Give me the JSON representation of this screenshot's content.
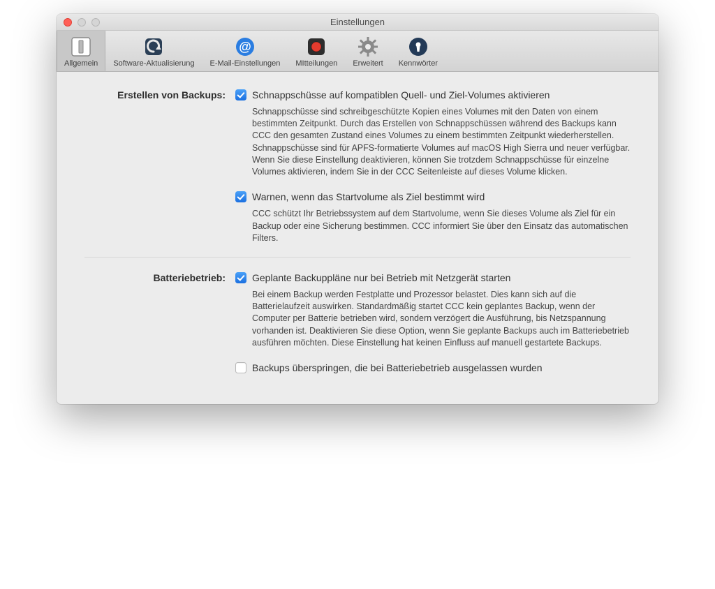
{
  "window_title": "Einstellungen",
  "toolbar": [
    {
      "label": "Allgemein",
      "selected": true
    },
    {
      "label": "Software-Aktualisierung",
      "selected": false
    },
    {
      "label": "E-Mail-Einstellungen",
      "selected": false
    },
    {
      "label": "MItteilungen",
      "selected": false
    },
    {
      "label": "Erweitert",
      "selected": false
    },
    {
      "label": "Kennwörter",
      "selected": false
    }
  ],
  "sections": {
    "backups": {
      "label": "Erstellen von Backups:",
      "options": [
        {
          "checked": true,
          "title": "Schnappschüsse auf kompatiblen Quell- und Ziel-Volumes aktivieren",
          "desc": "Schnappschüsse sind schreibgeschützte Kopien eines Volumes mit den Daten von einem bestimmten Zeitpunkt. Durch das Erstellen von Schnappschüssen während des Backups kann CCC den gesamten Zustand eines Volumes zu einem bestimmten Zeitpunkt wiederherstellen. Schnappschüsse sind für APFS-formatierte Volumes auf macOS High Sierra und neuer verfügbar. Wenn Sie diese Einstellung deaktivieren, können Sie trotzdem Schnappschüsse für einzelne Volumes aktivieren, indem Sie in der CCC Seitenleiste auf dieses Volume klicken."
        },
        {
          "checked": true,
          "title": "Warnen, wenn das Startvolume als Ziel bestimmt wird",
          "desc": "CCC schützt Ihr Betriebssystem auf dem Startvolume, wenn Sie dieses Volume als Ziel für ein Backup oder eine Sicherung bestimmen. CCC informiert Sie über den Einsatz das automatischen Filters."
        }
      ]
    },
    "battery": {
      "label": "Batteriebetrieb:",
      "options": [
        {
          "checked": true,
          "title": "Geplante Backuppläne nur bei Betrieb mit Netzgerät starten",
          "desc": "Bei einem Backup werden Festplatte und Prozessor belastet. Dies kann sich auf die Batterielaufzeit auswirken. Standardmäßig startet CCC kein geplantes Backup, wenn der Computer per Batterie betrieben wird, sondern verzögert die Ausführung, bis Netzspannung vorhanden ist. Deaktivieren Sie diese Option, wenn Sie geplante Backups auch im Batteriebetrieb ausführen möchten. Diese Einstellung hat keinen Einfluss auf manuell gestartete Backups."
        },
        {
          "checked": false,
          "title": "Backups überspringen, die bei Batteriebetrieb ausgelassen wurden",
          "desc": ""
        }
      ]
    }
  }
}
